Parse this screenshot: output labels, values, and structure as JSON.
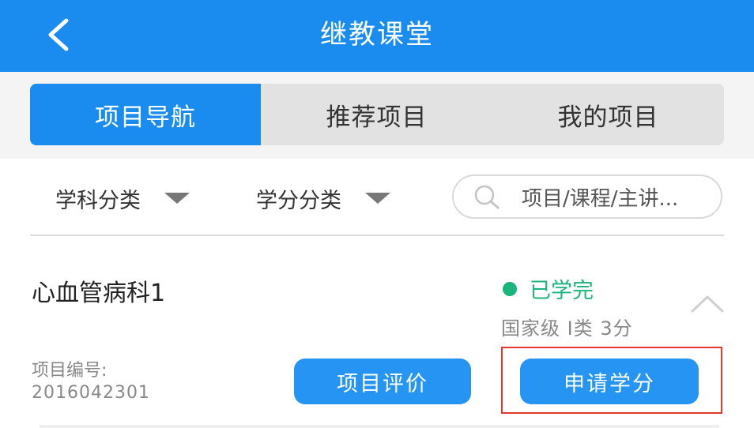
{
  "header": {
    "title": "继教课堂"
  },
  "tabs": [
    {
      "label": "项目导航",
      "active": true
    },
    {
      "label": "推荐项目",
      "active": false
    },
    {
      "label": "我的项目",
      "active": false
    }
  ],
  "filters": {
    "subject": "学科分类",
    "credit": "学分分类",
    "search_placeholder": "项目/课程/主讲..."
  },
  "project": {
    "title": "心血管病科1",
    "status": "已学完",
    "meta": "国家级 I类 3分",
    "code_label": "项目编号:",
    "code_value": "2016042301",
    "evaluate_label": "项目评价",
    "apply_label": "申请学分"
  },
  "colors": {
    "primary": "#1a8cf0",
    "status_green": "#19b57a",
    "highlight_red": "#e0382a"
  }
}
